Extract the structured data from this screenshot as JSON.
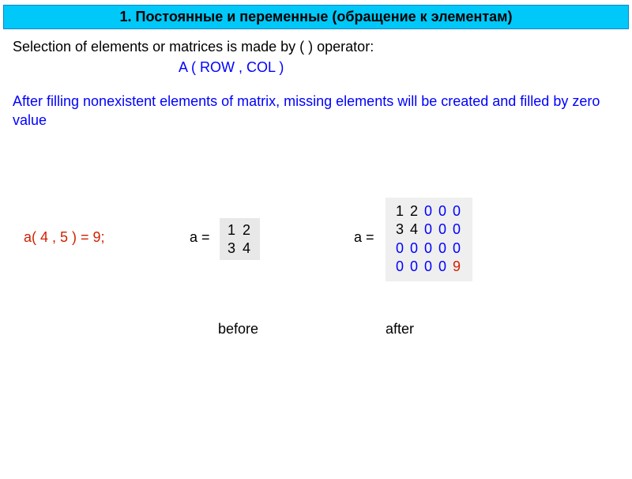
{
  "title": "1. Постоянные и переменные  (обращение к элементам)",
  "intro": "Selection of elements or matrices is made by ( ) operator:",
  "syntax": "A ( ROW , COL )",
  "note": "After filling nonexistent  elements of matrix, missing elements will be created and filled by zero value",
  "code_assign": "a( 4 , 5 ) = 9;",
  "a_eq": "a =",
  "matrix_before": {
    "r1": "1  2",
    "r2": "3  4"
  },
  "matrix_after": {
    "rows": [
      [
        {
          "v": "1",
          "c": "black"
        },
        {
          "v": "2",
          "c": "black"
        },
        {
          "v": "0",
          "c": "blue"
        },
        {
          "v": "0",
          "c": "blue"
        },
        {
          "v": "0",
          "c": "blue"
        }
      ],
      [
        {
          "v": "3",
          "c": "black"
        },
        {
          "v": "4",
          "c": "black"
        },
        {
          "v": "0",
          "c": "blue"
        },
        {
          "v": "0",
          "c": "blue"
        },
        {
          "v": "0",
          "c": "blue"
        }
      ],
      [
        {
          "v": "0",
          "c": "blue"
        },
        {
          "v": "0",
          "c": "blue"
        },
        {
          "v": "0",
          "c": "blue"
        },
        {
          "v": "0",
          "c": "blue"
        },
        {
          "v": "0",
          "c": "blue"
        }
      ],
      [
        {
          "v": "0",
          "c": "blue"
        },
        {
          "v": "0",
          "c": "blue"
        },
        {
          "v": "0",
          "c": "blue"
        },
        {
          "v": "0",
          "c": "blue"
        },
        {
          "v": "9",
          "c": "red"
        }
      ]
    ]
  },
  "label_before": "before",
  "label_after": "after"
}
